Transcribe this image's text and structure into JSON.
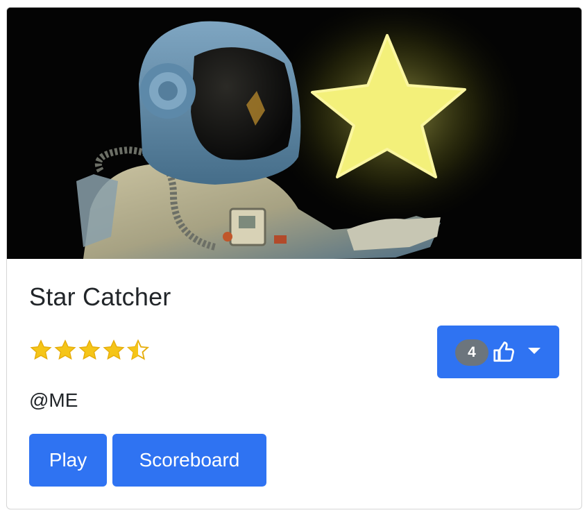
{
  "game": {
    "title": "Star Catcher",
    "rating": 4.5,
    "rating_max": 5,
    "author": "@ME"
  },
  "like": {
    "count": "4",
    "icon": "thumbs-up-icon"
  },
  "buttons": {
    "play_label": "Play",
    "scoreboard_label": "Scoreboard"
  },
  "colors": {
    "primary": "#2f73f2",
    "badge": "#6c757d",
    "star": "#f5c518"
  }
}
